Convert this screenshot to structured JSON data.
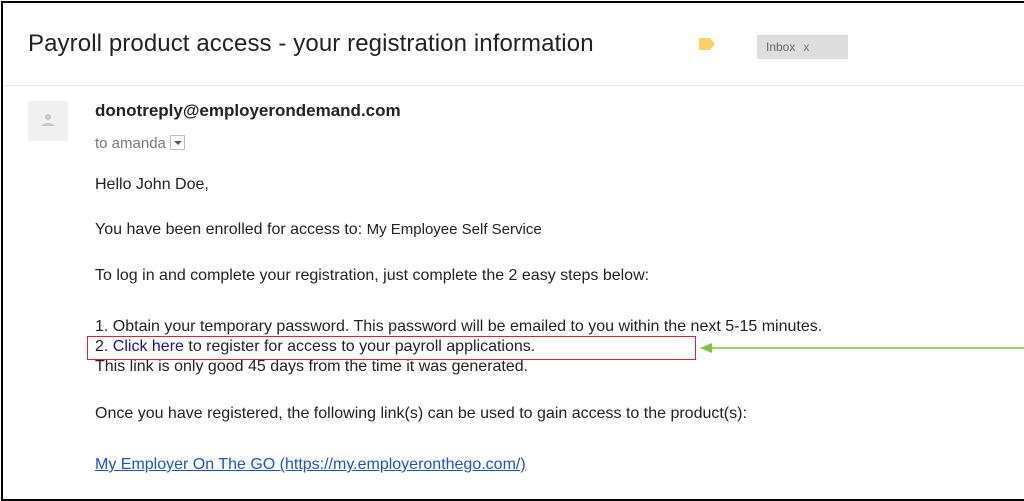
{
  "email": {
    "subject": "Payroll product access - your registration information",
    "label_chip": {
      "text": "Inbox",
      "close": "x"
    },
    "sender": "donotreply@employerondemand.com",
    "recipient_line": "to amanda",
    "greeting": "Hello John Doe,",
    "enrolled_prefix": "You have been enrolled for access to:",
    "enrolled_product": "My Employee Self Service",
    "instructions": "To log in and complete your registration, just complete the 2 easy steps below:",
    "step1": "1. Obtain your temporary password. This password will be emailed to you within the next 5-15 minutes.",
    "step2_prefix": "2.",
    "step2_link": "Click here",
    "step2_suffix": "to register for access to your payroll applications.",
    "validity": "This link is only good 45 days from the time it was generated.",
    "access_intro": "Once you have registered, the following link(s) can be used to gain access to the product(s):",
    "product_link": "My Employer On The GO (https://my.employeronthego.com/)"
  },
  "colors": {
    "label_tag": "#fad165",
    "highlight_box": "#e0222b",
    "arrow": "#7cc242",
    "link": "#1a0dab"
  },
  "icons": {
    "label_tag": "label-tag-icon",
    "avatar": "person-icon",
    "dropdown": "chevron-down-icon",
    "arrow": "arrow-left-icon"
  }
}
